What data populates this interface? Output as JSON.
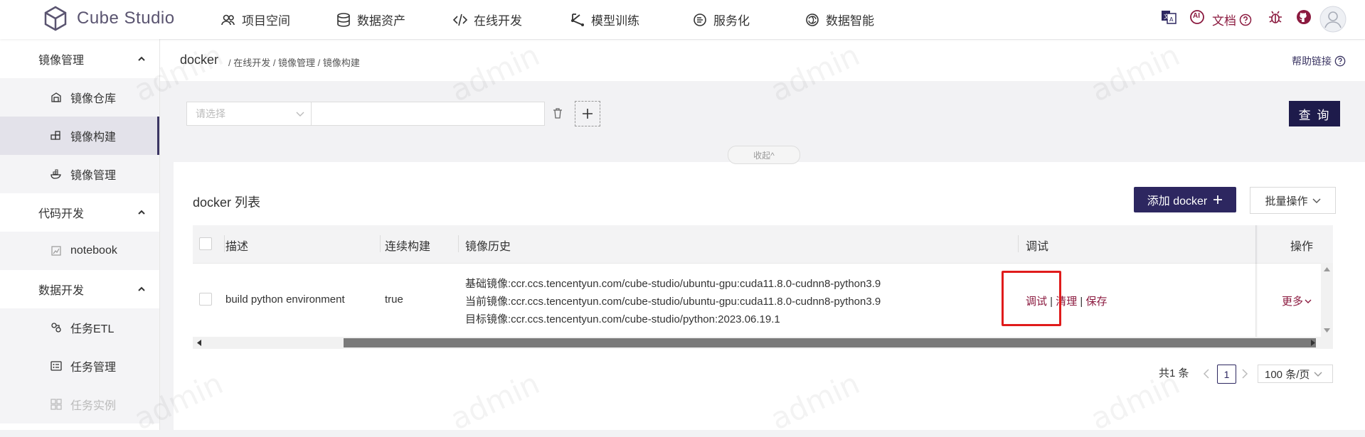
{
  "app": {
    "name": "Cube Studio"
  },
  "topnav": [
    {
      "label": "项目空间",
      "icon": "users-icon"
    },
    {
      "label": "数据资产",
      "icon": "database-icon"
    },
    {
      "label": "在线开发",
      "icon": "code-icon"
    },
    {
      "label": "模型训练",
      "icon": "model-icon"
    },
    {
      "label": "服务化",
      "icon": "service-icon"
    },
    {
      "label": "数据智能",
      "icon": "ai-swirl-icon"
    }
  ],
  "topright": {
    "docs_label": "文档",
    "ai_label": "AI"
  },
  "sidebar": {
    "groups": [
      {
        "label": "镜像管理",
        "items": [
          "镜像仓库",
          "镜像构建",
          "镜像管理"
        ]
      },
      {
        "label": "代码开发",
        "items": [
          "notebook"
        ]
      },
      {
        "label": "数据开发",
        "items": [
          "任务ETL",
          "任务管理",
          "任务实例"
        ]
      }
    ],
    "active_item": "镜像构建"
  },
  "header": {
    "title": "docker",
    "breadcrumb": "/ 在线开发 / 镜像管理 / 镜像构建",
    "help_link": "帮助链接"
  },
  "filter": {
    "select_placeholder": "请选择",
    "query_button": "查 询",
    "collapse_label": "收起^"
  },
  "list": {
    "title": "docker 列表",
    "add_button": "添加 docker",
    "batch_button": "批量操作"
  },
  "table": {
    "columns": [
      "描述",
      "连续构建",
      "镜像历史",
      "调试",
      "操作"
    ],
    "rows": [
      {
        "description": "build python environment",
        "continuous_build": "true",
        "history": [
          "基础镜像:ccr.ccs.tencentyun.com/cube-studio/ubuntu-gpu:cuda11.8.0-cudnn8-python3.9",
          "当前镜像:ccr.ccs.tencentyun.com/cube-studio/ubuntu-gpu:cuda11.8.0-cudnn8-python3.9",
          "目标镜像:ccr.ccs.tencentyun.com/cube-studio/python:2023.06.19.1"
        ],
        "debug_actions": [
          "调试",
          "清理",
          "保存"
        ],
        "more": "更多"
      }
    ]
  },
  "pagination": {
    "total": "共1 条",
    "current_page": "1",
    "page_size": "100 条/页"
  },
  "watermark": "admin",
  "colors": {
    "brand": "#2d2760",
    "link": "#8b1a3f",
    "highlight": "#e01b1b"
  }
}
